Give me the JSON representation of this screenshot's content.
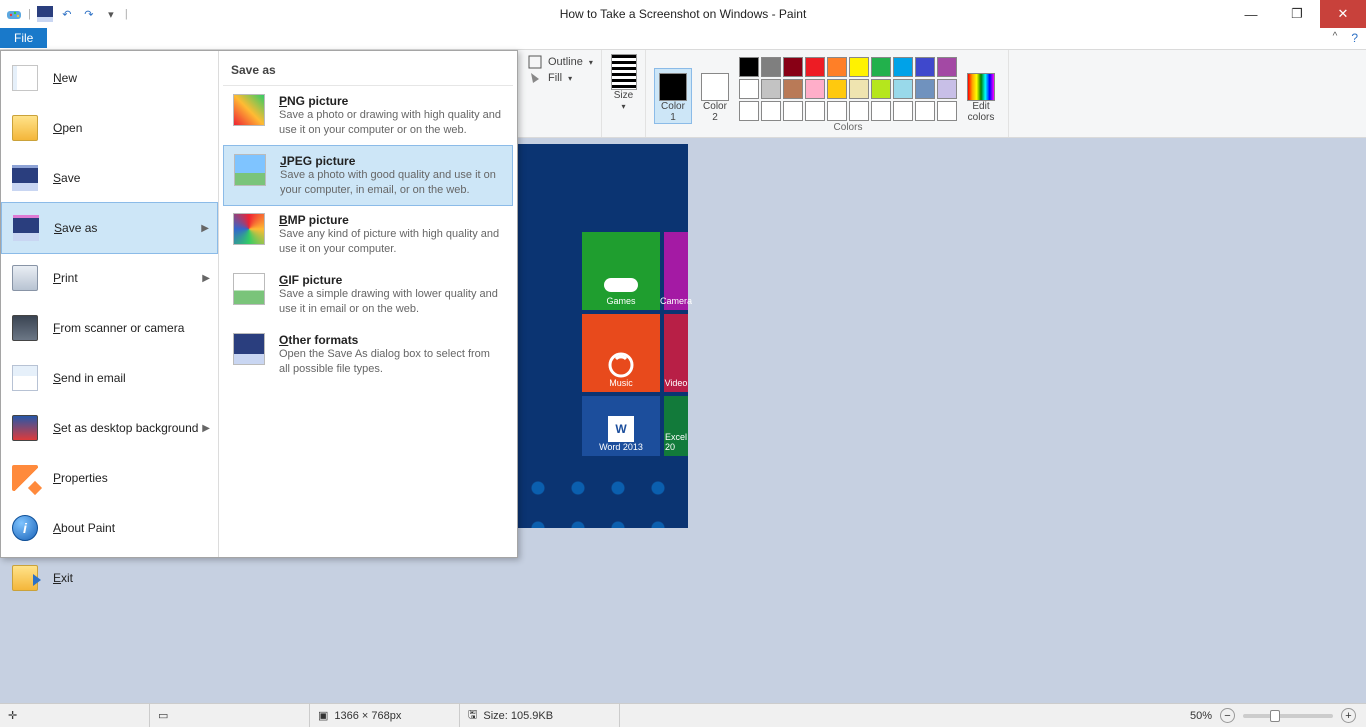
{
  "window": {
    "title": "How to Take a Screenshot on Windows - Paint",
    "file_tab": "File",
    "min_glyph": "—",
    "max_glyph": "❐",
    "close_glyph": "✕",
    "help_glyph": "?",
    "collapse_glyph": "^"
  },
  "ribbon": {
    "outline": "Outline",
    "fill": "Fill",
    "size": "Size",
    "color1": "Color\n1",
    "color2": "Color\n2",
    "edit_colors": "Edit\ncolors",
    "colors_label": "Colors",
    "color1_hex": "#000000",
    "color2_hex": "#ffffff",
    "palette_row1": [
      "#000000",
      "#7f7f7f",
      "#880015",
      "#ed1c24",
      "#ff7f27",
      "#fff200",
      "#22b14c",
      "#00a2e8",
      "#3f48cc",
      "#a349a4"
    ],
    "palette_row2": [
      "#ffffff",
      "#c3c3c3",
      "#b97a57",
      "#ffaec9",
      "#ffc90e",
      "#efe4b0",
      "#b5e61d",
      "#99d9ea",
      "#7092be",
      "#c8bfe7"
    ],
    "palette_row3": [
      "#ffffff",
      "#ffffff",
      "#ffffff",
      "#ffffff",
      "#ffffff",
      "#ffffff",
      "#ffffff",
      "#ffffff",
      "#ffffff",
      "#ffffff"
    ]
  },
  "file_menu": {
    "items": [
      {
        "label": "New",
        "arrow": false
      },
      {
        "label": "Open",
        "arrow": false
      },
      {
        "label": "Save",
        "arrow": false
      },
      {
        "label": "Save as",
        "arrow": true,
        "hover": true
      },
      {
        "label": "Print",
        "arrow": true
      },
      {
        "label": "From scanner or camera",
        "arrow": false
      },
      {
        "label": "Send in email",
        "arrow": false
      },
      {
        "label": "Set as desktop background",
        "arrow": true
      },
      {
        "label": "Properties",
        "arrow": false
      },
      {
        "label": "About Paint",
        "arrow": false
      },
      {
        "label": "Exit",
        "arrow": false
      }
    ],
    "right_header": "Save as",
    "saveas": [
      {
        "title": "PNG picture",
        "desc": "Save a photo or drawing with high quality and use it on your computer or on the web."
      },
      {
        "title": "JPEG picture",
        "desc": "Save a photo with good quality and use it on your computer, in email, or on the web.",
        "hover": true
      },
      {
        "title": "BMP picture",
        "desc": "Save any kind of picture with high quality and use it on your computer."
      },
      {
        "title": "GIF picture",
        "desc": "Save a simple drawing with lower quality and use it in email or on the web."
      },
      {
        "title": "Other formats",
        "desc": "Open the Save As dialog box to select from all possible file types."
      }
    ]
  },
  "canvas_tiles": {
    "games": "Games",
    "camera": "Camera",
    "music": "Music",
    "video": "Video",
    "word": "Word 2013",
    "excel": "Excel 20"
  },
  "status": {
    "dimensions": "1366 × 768px",
    "size": "Size: 105.9KB",
    "zoom": "50%",
    "minus": "−",
    "plus": "+"
  }
}
